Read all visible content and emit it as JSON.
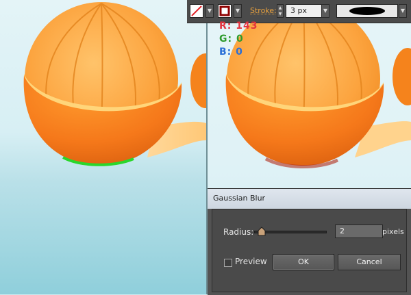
{
  "toolbar": {
    "stroke_label": "Stroke:",
    "stroke_weight": "3 px",
    "fill_icon": "no-fill-swatch-icon",
    "stroke_icon": "stroke-swatch-icon",
    "profile_icon": "width-profile-icon"
  },
  "color_readout": {
    "r_label": "R:",
    "r_value": "143",
    "g_label": "G:",
    "g_value": "0",
    "b_label": "B:",
    "b_value": "0",
    "r_color": "#e4333e",
    "g_color": "#2e9b2e",
    "b_color": "#2a6fd6"
  },
  "dialog": {
    "title": "Gaussian Blur",
    "radius_label": "Radius:",
    "radius_value": "2",
    "radius_unit": "pixels",
    "preview_label": "Preview",
    "preview_checked": false,
    "ok_label": "OK",
    "cancel_label": "Cancel"
  },
  "colors": {
    "orange": "#f58a1f",
    "stroke_highlight": "#2bd62b",
    "toolbar_bg": "#4b4b4b",
    "dialog_bg": "#535353"
  }
}
